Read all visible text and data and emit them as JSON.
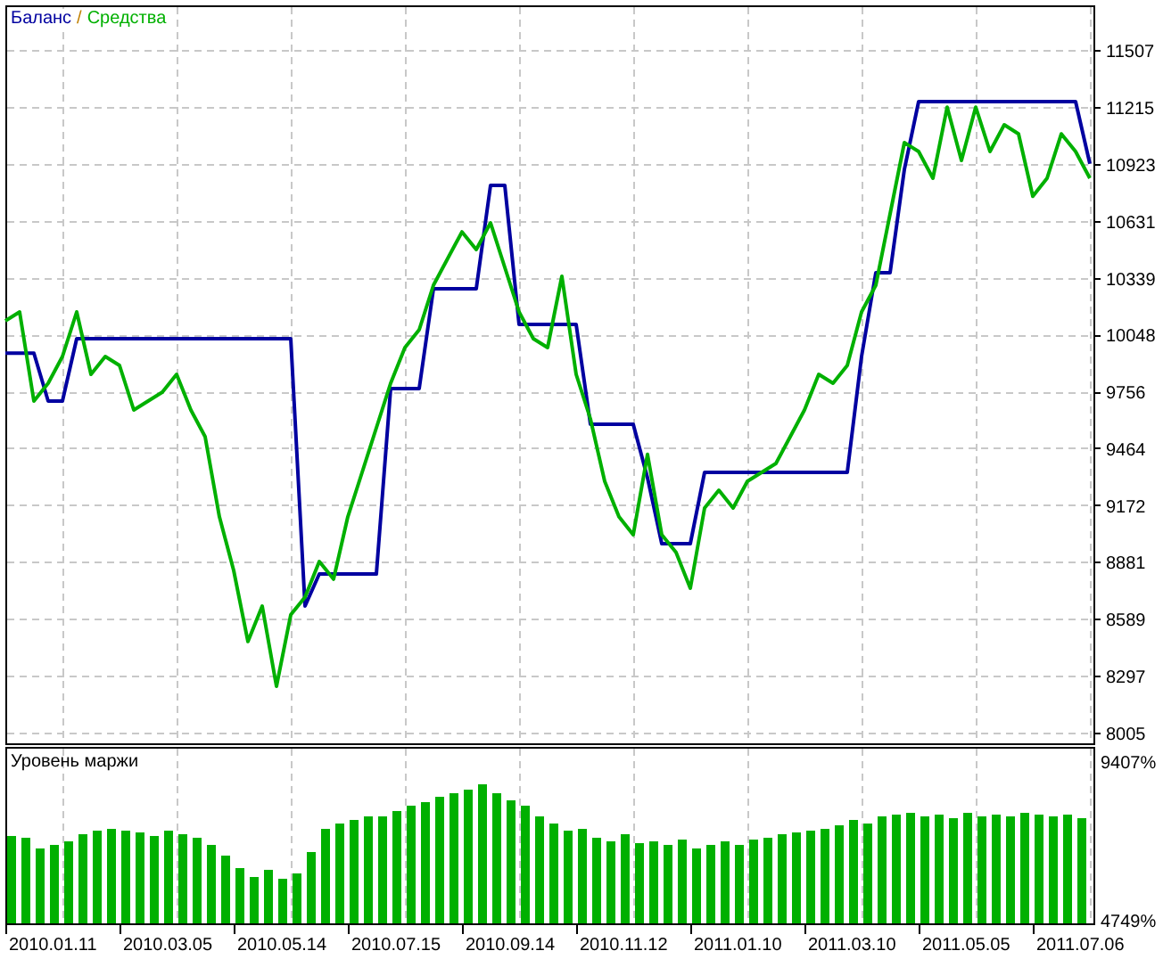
{
  "main_chart": {
    "separator": "/",
    "chart_data": {
      "type": "line",
      "grid": true,
      "ylim": [
        7950,
        11736
      ],
      "yticks": [
        8005,
        8297,
        8589,
        8881,
        9172,
        9464,
        9756,
        10048,
        10339,
        10631,
        10923,
        11215,
        11507
      ],
      "series": [
        {
          "name": "Баланс",
          "color": "#0000a0",
          "values": [
            9952,
            9952,
            9952,
            9706,
            9706,
            10026,
            10026,
            10026,
            10026,
            10026,
            10026,
            10026,
            10026,
            10026,
            10026,
            10026,
            10026,
            10026,
            10026,
            10026,
            10026,
            8654,
            8819,
            8819,
            8819,
            8819,
            8819,
            9770,
            9770,
            9770,
            10282,
            10282,
            10282,
            10282,
            10812,
            10812,
            10099,
            10099,
            10099,
            10099,
            10099,
            9587,
            9587,
            9587,
            9587,
            9313,
            8974,
            8974,
            8974,
            9340,
            9340,
            9340,
            9340,
            9340,
            9340,
            9340,
            9340,
            9340,
            9340,
            9340,
            9934,
            10364,
            10364,
            10894,
            11242,
            11242,
            11242,
            11242,
            11242,
            11242,
            11242,
            11242,
            11242,
            11242,
            11242,
            11242,
            10923
          ]
        },
        {
          "name": "Средства",
          "color": "#00b000",
          "values": [
            10117,
            10163,
            9706,
            9797,
            9934,
            10163,
            9843,
            9934,
            9889,
            9660,
            9706,
            9752,
            9843,
            9660,
            9523,
            9112,
            8837,
            8472,
            8654,
            8243,
            8609,
            8700,
            8883,
            8792,
            9112,
            9340,
            9569,
            9797,
            9980,
            10072,
            10300,
            10437,
            10574,
            10483,
            10620,
            10392,
            10163,
            10026,
            9980,
            10346,
            9843,
            9614,
            9294,
            9112,
            9020,
            9432,
            9020,
            8929,
            8746,
            9157,
            9249,
            9157,
            9294,
            9340,
            9386,
            9523,
            9660,
            9843,
            9797,
            9889,
            10163,
            10300,
            10666,
            11032,
            10986,
            10849,
            11214,
            10940,
            11214,
            10986,
            11123,
            11077,
            10757,
            10849,
            11077,
            10986,
            10849
          ]
        }
      ]
    }
  },
  "margin_chart": {
    "chart_data": {
      "type": "bar",
      "grid": true,
      "ylim": [
        4644,
        9773
      ],
      "yticks": [
        {
          "value": 4749,
          "label": "4749%"
        },
        {
          "value": 9407,
          "label": "9407%"
        }
      ],
      "series": [
        {
          "name": "Уровень маржи",
          "color": "#00b000",
          "values": [
            7209,
            7157,
            6843,
            6947,
            7052,
            7261,
            7366,
            7418,
            7366,
            7314,
            7209,
            7366,
            7261,
            7157,
            6947,
            6633,
            6267,
            6005,
            6215,
            5953,
            6110,
            6738,
            7418,
            7575,
            7680,
            7785,
            7785,
            7942,
            8099,
            8203,
            8360,
            8465,
            8570,
            8727,
            8465,
            8256,
            8099,
            7785,
            7575,
            7366,
            7418,
            7157,
            7052,
            7261,
            7000,
            7052,
            6947,
            7104,
            6843,
            6947,
            7052,
            6947,
            7104,
            7157,
            7261,
            7314,
            7366,
            7418,
            7523,
            7680,
            7575,
            7785,
            7837,
            7889,
            7785,
            7837,
            7732,
            7889,
            7785,
            7837,
            7785,
            7889,
            7837,
            7785,
            7837,
            7732
          ]
        }
      ]
    }
  },
  "date_labels": [
    "2010.01.11",
    "2010.03.05",
    "2010.05.14",
    "2010.07.15",
    "2010.09.14",
    "2010.11.12",
    "2011.01.10",
    "2011.03.10",
    "2011.05.05",
    "2011.07.06"
  ]
}
